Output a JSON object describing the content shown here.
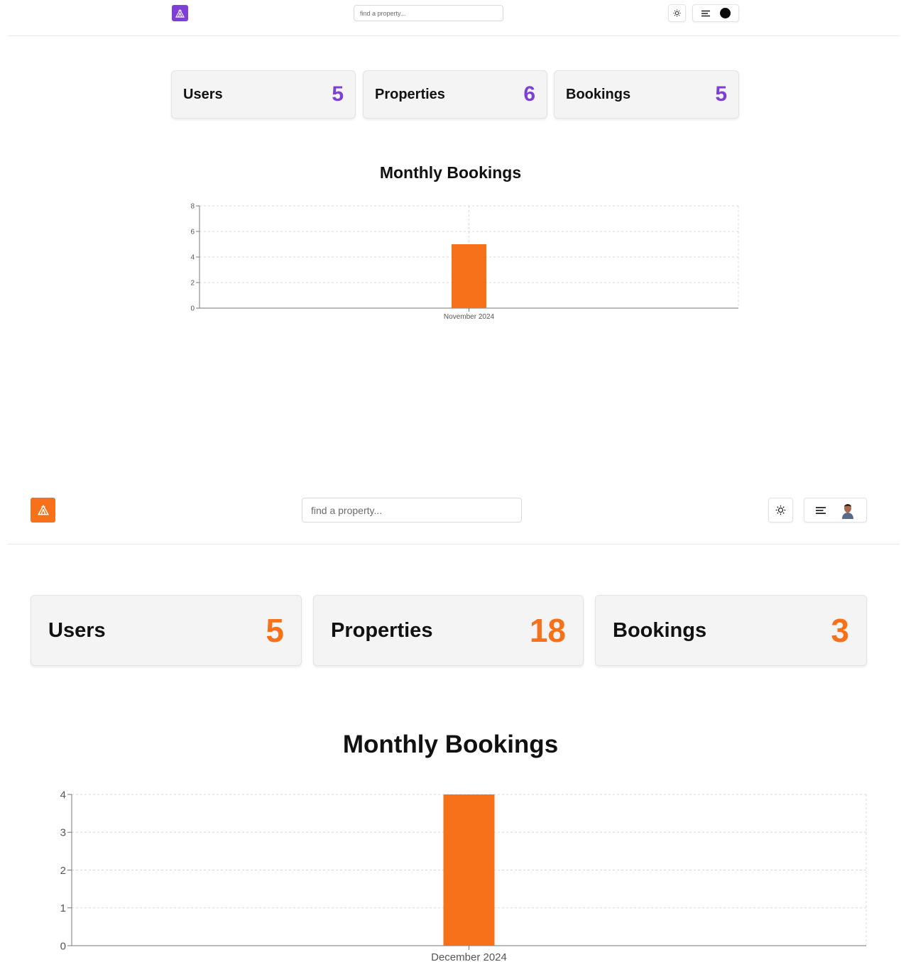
{
  "panels": [
    {
      "id": "top",
      "theme_color": "#7e3fd6",
      "search": {
        "placeholder": "find a property..."
      },
      "stats": [
        {
          "label": "Users",
          "value": "5"
        },
        {
          "label": "Properties",
          "value": "6"
        },
        {
          "label": "Bookings",
          "value": "5"
        }
      ],
      "chart_title": "Monthly Bookings",
      "avatar": "dark-circle",
      "icons": {
        "logo": "camp-tent-icon",
        "theme_toggle": "sun-icon",
        "menu": "menu-lines-icon"
      }
    },
    {
      "id": "bottom",
      "theme_color": "#f7701a",
      "search": {
        "placeholder": "find a property..."
      },
      "stats": [
        {
          "label": "Users",
          "value": "5"
        },
        {
          "label": "Properties",
          "value": "18"
        },
        {
          "label": "Bookings",
          "value": "3"
        }
      ],
      "chart_title": "Monthly Bookings",
      "avatar": "user-photo",
      "icons": {
        "logo": "camp-tent-icon",
        "theme_toggle": "sun-icon",
        "menu": "menu-lines-icon"
      }
    }
  ],
  "chart_data": [
    {
      "type": "bar",
      "title": "Monthly Bookings",
      "categories": [
        "November 2024"
      ],
      "values": [
        5
      ],
      "ylim": [
        0,
        8
      ],
      "yticks": [
        "0",
        "2",
        "4",
        "6",
        "8"
      ],
      "color": "#f7701a",
      "grid": true
    },
    {
      "type": "bar",
      "title": "Monthly Bookings",
      "categories": [
        "December 2024"
      ],
      "values": [
        4
      ],
      "ylim": [
        0,
        4
      ],
      "yticks": [
        "0",
        "1",
        "2",
        "3",
        "4"
      ],
      "color": "#f7701a",
      "grid": true
    }
  ]
}
